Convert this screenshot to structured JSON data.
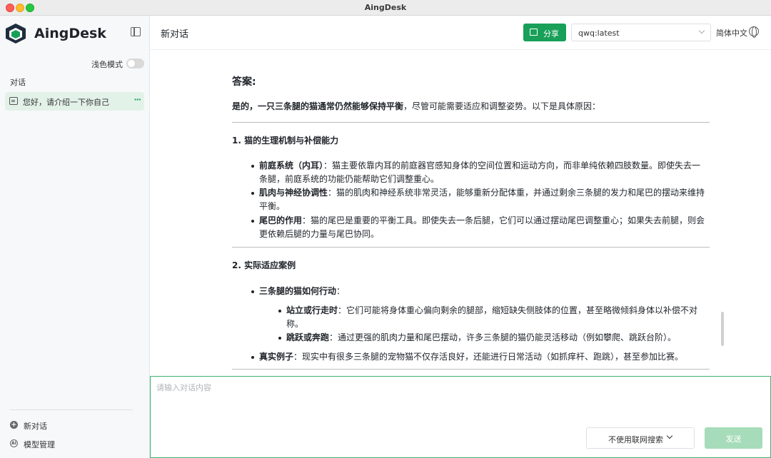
{
  "window": {
    "title": "AingDesk"
  },
  "sidebar": {
    "brand": "AingDesk",
    "theme_label": "浅色模式",
    "section_label": "对话",
    "conversations": [
      {
        "label": "您好，请介绍一下你自己",
        "more": "···"
      }
    ],
    "actions": {
      "new_chat": "新对话",
      "model_manage": "模型管理",
      "ai_badge": "AI"
    }
  },
  "header": {
    "title": "新对话",
    "share_label": "分享",
    "model_value": "qwq:latest",
    "language": "简体中文"
  },
  "answer": {
    "title": "答案:",
    "intro_bold": "是的，一只三条腿的猫通常仍然能够保持平衡",
    "intro_rest": "，尽管可能需要适应和调整姿势。以下是具体原因：",
    "section1": {
      "heading": "1. 猫的生理机制与补偿能力",
      "items": [
        {
          "bold": "前庭系统（内耳）",
          "text": "：猫主要依靠内耳的前庭器官感知身体的空间位置和运动方向，而非单纯依赖四肢数量。即使失去一条腿，前庭系统的功能仍能帮助它们调整重心。"
        },
        {
          "bold": "肌肉与神经协调性",
          "text": "：猫的肌肉和神经系统非常灵活，能够重新分配体重，并通过剩余三条腿的发力和尾巴的摆动来维持平衡。"
        },
        {
          "bold": "尾巴的作用",
          "text": "：猫的尾巴是重要的平衡工具。即使失去一条后腿，它们可以通过摆动尾巴调整重心；如果失去前腿，则会更依赖后腿的力量与尾巴协同。"
        }
      ]
    },
    "section2": {
      "heading": "2. 实际适应案例",
      "item1_bold": "三条腿的猫如何行动",
      "item1_colon": "：",
      "sub_items": [
        {
          "bold": "站立或行走时",
          "text": "：它们可能将身体重心偏向剩余的腿部，缩短缺失侧肢体的位置，甚至略微倾斜身体以补偿不对称。"
        },
        {
          "bold": "跳跃或奔跑",
          "text": "：通过更强的肌肉力量和尾巴摆动，许多三条腿的猫仍能灵活移动（例如攀爬、跳跃台阶）。"
        }
      ],
      "item2_bold": "真实例子",
      "item2_text": "：现实中有很多三条腿的宠物猫不仅存活良好，还能进行日常活动（如抓痒杆、跑跳），甚至参加比赛。"
    }
  },
  "input": {
    "placeholder": "请输入对话内容",
    "web_search_label": "不使用联网搜索",
    "send_label": "发送"
  }
}
